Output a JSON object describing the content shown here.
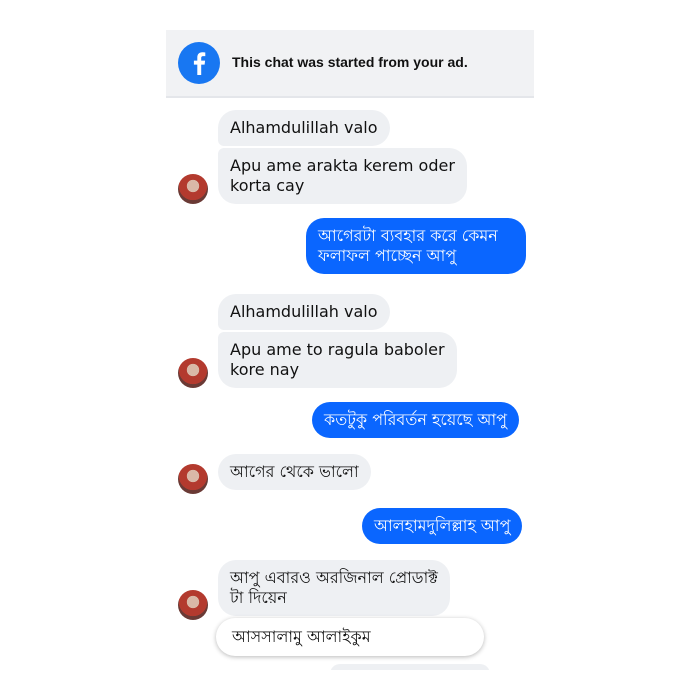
{
  "banner": {
    "icon": "facebook-icon",
    "text": "This chat was started from your ad.",
    "color": "#1877f2"
  },
  "messages": [
    {
      "side": "in",
      "text": "Alhamdulillah valo"
    },
    {
      "side": "in",
      "text": "Apu ame arakta kerem oder\nkorta cay"
    },
    {
      "side": "out",
      "text": "আগেরটা ব্যবহার করে কেমন\nফলাফল পাচ্ছেন আপু"
    },
    {
      "side": "in",
      "text": "Alhamdulillah valo"
    },
    {
      "side": "in",
      "text": "Apu ame to ragula baboler\nkore nay"
    },
    {
      "side": "out",
      "text": "কতটুকু পরিবর্তন হয়েছে আপু"
    },
    {
      "side": "in",
      "text": "আগের থেকে ভালো"
    },
    {
      "side": "out",
      "text": "আলহামদুলিল্লাহ আপু"
    },
    {
      "side": "in",
      "text": "আপু এবারও অরজিনাল প্রোডাক্ট\nটা দিয়েন"
    }
  ],
  "quick_reply": {
    "text": "আসসালামু আলাইকুম"
  },
  "colors": {
    "incoming_bubble": "#eef0f3",
    "outgoing_bubble": "#0a66ff"
  }
}
